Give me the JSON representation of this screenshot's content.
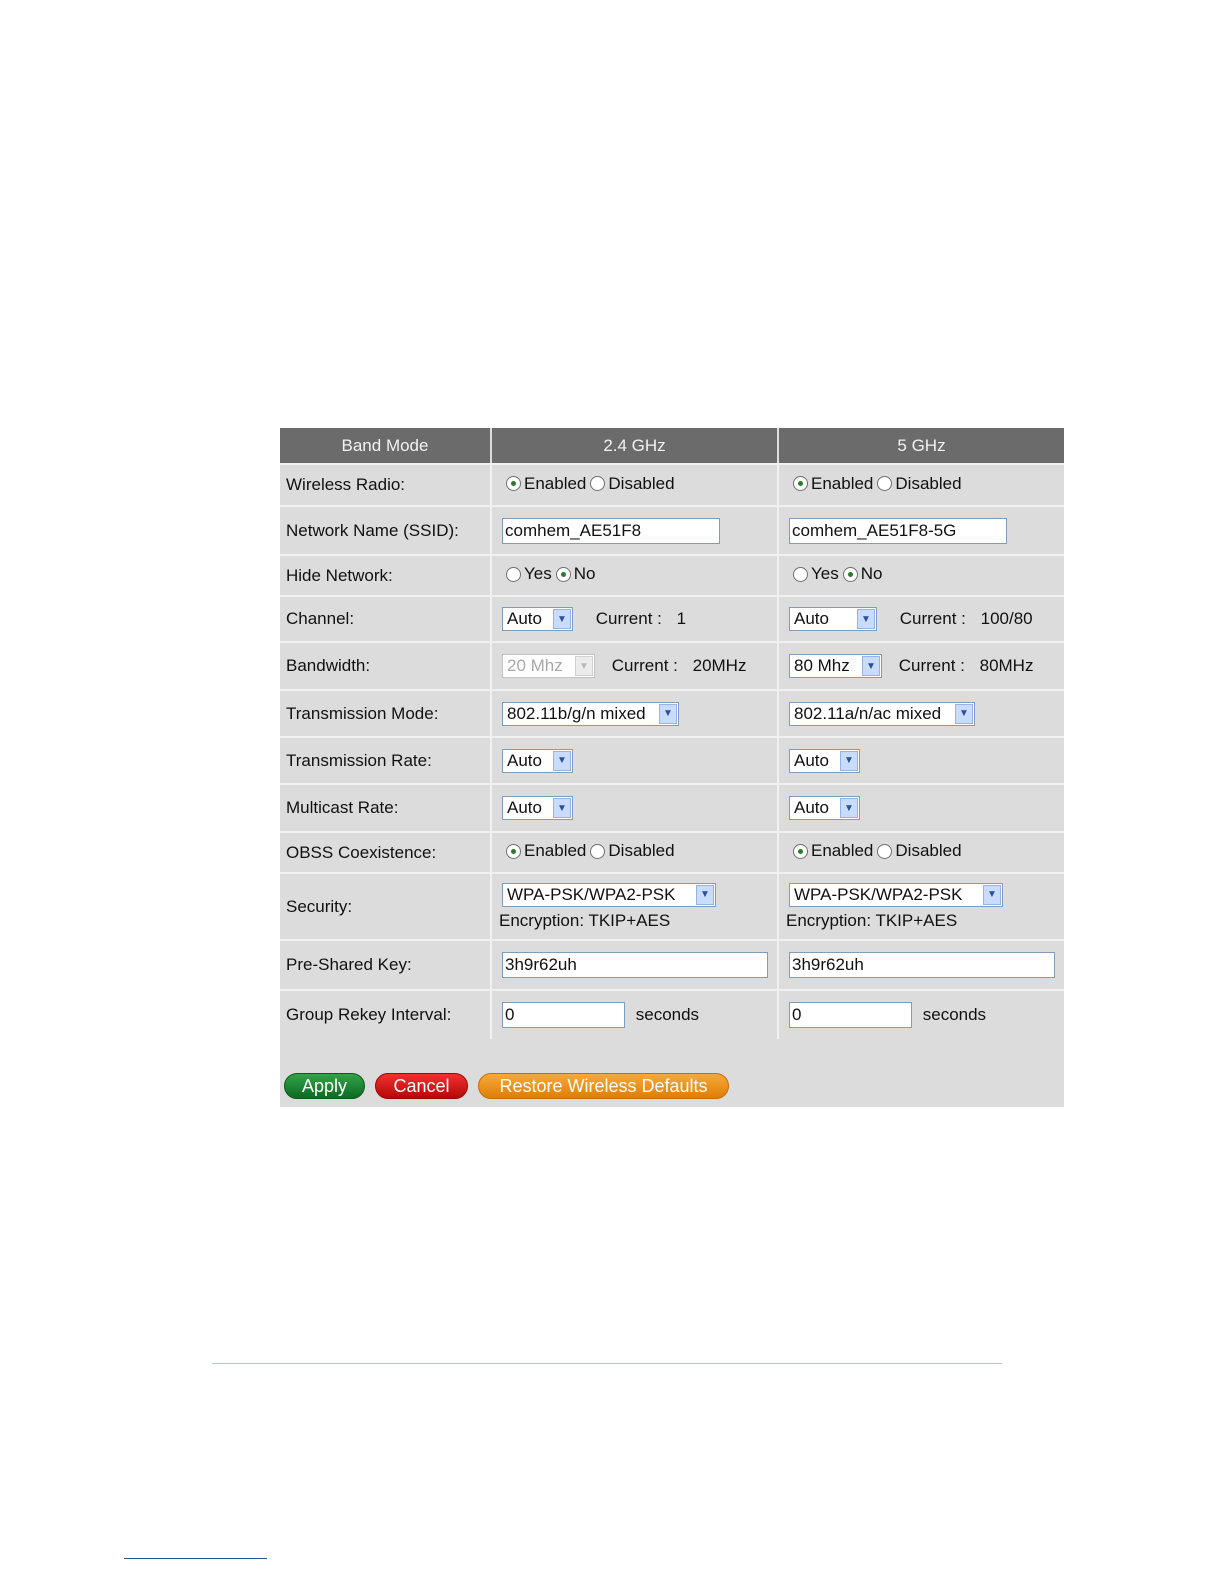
{
  "header": {
    "band_mode": "Band Mode",
    "col_24": "2.4 GHz",
    "col_5": "5 GHz"
  },
  "labels": {
    "wireless_radio": "Wireless Radio:",
    "ssid": "Network Name (SSID):",
    "hide_network": "Hide Network:",
    "channel": "Channel:",
    "bandwidth": "Bandwidth:",
    "transmission_mode": "Transmission Mode:",
    "transmission_rate": "Transmission Rate:",
    "multicast_rate": "Multicast Rate:",
    "obss": "OBSS Coexistence:",
    "security": "Security:",
    "psk": "Pre-Shared Key:",
    "rekey": "Group Rekey Interval:"
  },
  "common": {
    "enabled": "Enabled",
    "disabled": "Disabled",
    "yes": "Yes",
    "no": "No",
    "current": "Current :",
    "seconds": "seconds",
    "encryption": "Encryption: TKIP+AES"
  },
  "band24": {
    "wireless_radio": "Enabled",
    "ssid": "comhem_AE51F8",
    "hide_network": "No",
    "channel": "Auto",
    "channel_current": "1",
    "bandwidth": "20 Mhz",
    "bandwidth_current": "20MHz",
    "transmission_mode": "802.11b/g/n mixed",
    "transmission_rate": "Auto",
    "multicast_rate": "Auto",
    "obss": "Enabled",
    "security": "WPA-PSK/WPA2-PSK",
    "psk": "3h9r62uh",
    "rekey": "0"
  },
  "band5": {
    "wireless_radio": "Enabled",
    "ssid": "comhem_AE51F8-5G",
    "hide_network": "No",
    "channel": "Auto",
    "channel_current": "100/80",
    "bandwidth": "80 Mhz",
    "bandwidth_current": "80MHz",
    "transmission_mode": "802.11a/n/ac mixed",
    "transmission_rate": "Auto",
    "multicast_rate": "Auto",
    "obss": "Enabled",
    "security": "WPA-PSK/WPA2-PSK",
    "psk": "3h9r62uh",
    "rekey": "0"
  },
  "buttons": {
    "apply": "Apply",
    "cancel": "Cancel",
    "restore": "Restore Wireless Defaults"
  },
  "colors": {
    "header_bg": "#6b6b6b",
    "panel_bg": "#dcdcdc",
    "apply": "#1a7f30",
    "cancel": "#d51515",
    "restore": "#ea8f18"
  }
}
